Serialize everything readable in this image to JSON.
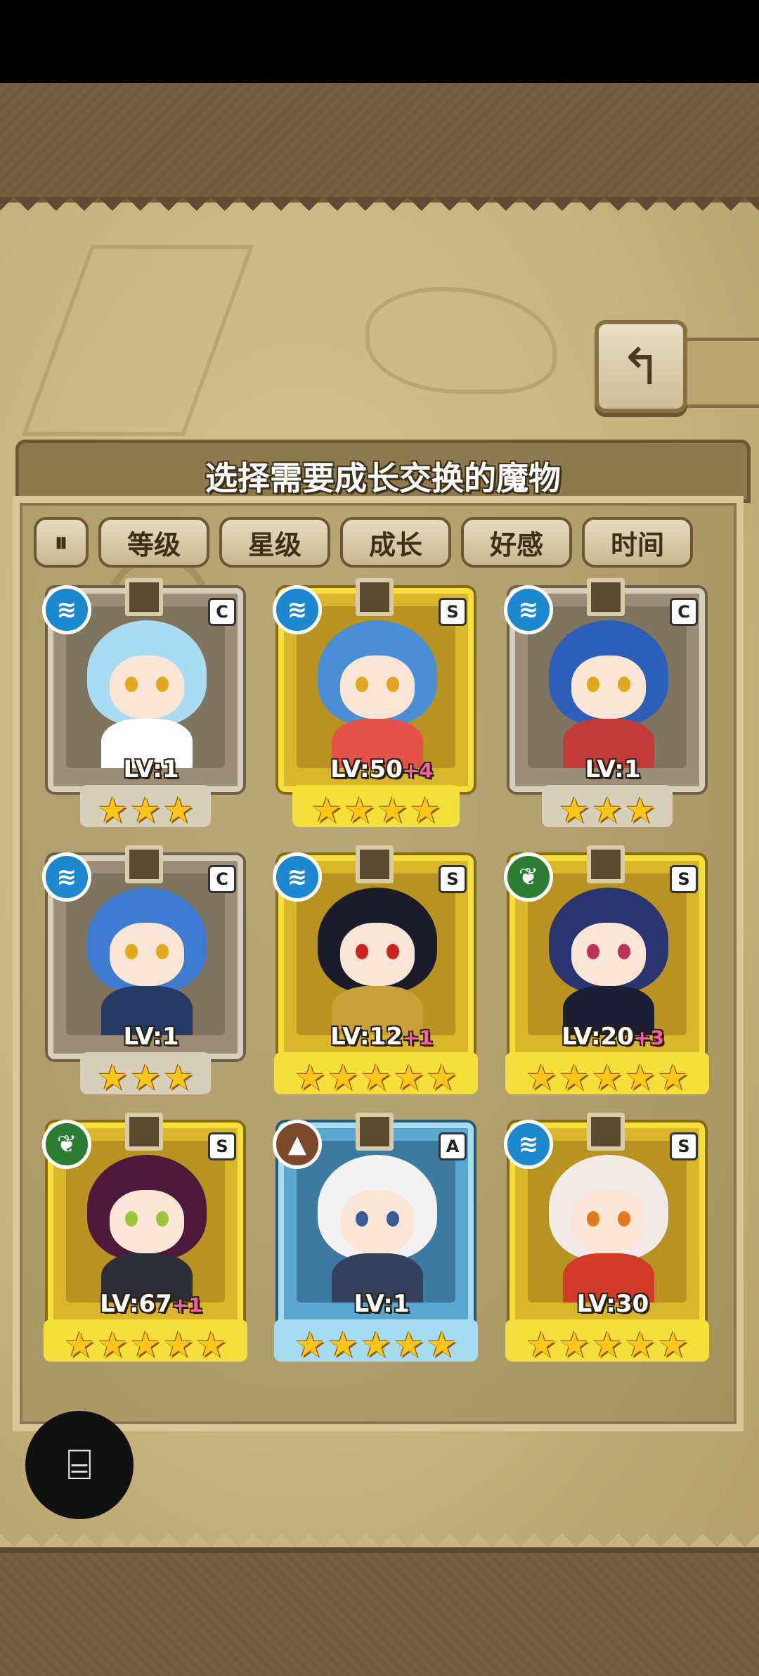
{
  "header": {
    "title": "选择需要成长交换的魔物",
    "back_icon": "↰"
  },
  "sort": {
    "toggle_label": "⏸",
    "buttons": [
      "等级",
      "星级",
      "成长",
      "好感",
      "时间"
    ]
  },
  "monsters": [
    {
      "element": "water",
      "rank": "C",
      "frame": "silver",
      "level": "LV:1",
      "plus": "",
      "stars": 3,
      "hair": "#a9dcf2",
      "eyes": "#e0a81a",
      "body": "#ffffff"
    },
    {
      "element": "water",
      "rank": "S",
      "frame": "gold",
      "level": "LV:50",
      "plus": "+4",
      "stars": 4,
      "hair": "#4a8fd6",
      "eyes": "#e0a81a",
      "body": "#e55247"
    },
    {
      "element": "water",
      "rank": "C",
      "frame": "silver",
      "level": "LV:1",
      "plus": "",
      "stars": 3,
      "hair": "#2c5fb8",
      "eyes": "#e0a81a",
      "body": "#c23a3a"
    },
    {
      "element": "water",
      "rank": "C",
      "frame": "silver",
      "level": "LV:1",
      "plus": "",
      "stars": 3,
      "hair": "#3f7cd1",
      "eyes": "#e0a81a",
      "body": "#263a66"
    },
    {
      "element": "water",
      "rank": "S",
      "frame": "gold",
      "level": "LV:12",
      "plus": "+1",
      "stars": 5,
      "hair": "#1b1b2a",
      "eyes": "#d02020",
      "body": "#c9a03a"
    },
    {
      "element": "nature",
      "rank": "S",
      "frame": "gold",
      "level": "LV:20",
      "plus": "+3",
      "stars": 5,
      "hair": "#2a3470",
      "eyes": "#c0305a",
      "body": "#1d1d33"
    },
    {
      "element": "nature",
      "rank": "S",
      "frame": "gold",
      "level": "LV:67",
      "plus": "+1",
      "stars": 5,
      "hair": "#4d1a3c",
      "eyes": "#9ac83a",
      "body": "#2e2e3a"
    },
    {
      "element": "earth",
      "rank": "A",
      "frame": "blue",
      "level": "LV:1",
      "plus": "",
      "stars": 5,
      "hair": "#f2f2f2",
      "eyes": "#3a5a9a",
      "body": "#34405e"
    },
    {
      "element": "water",
      "rank": "S",
      "frame": "gold",
      "level": "LV:30",
      "plus": "",
      "stars": 5,
      "hair": "#f0ebe6",
      "eyes": "#e07a1a",
      "body": "#d23a2a"
    }
  ],
  "fab": {
    "icon": "⌸"
  },
  "colors": {
    "star": "#ffc617",
    "plus": "#ff5ea6",
    "panel_title_bg": "#8d7a4e"
  }
}
